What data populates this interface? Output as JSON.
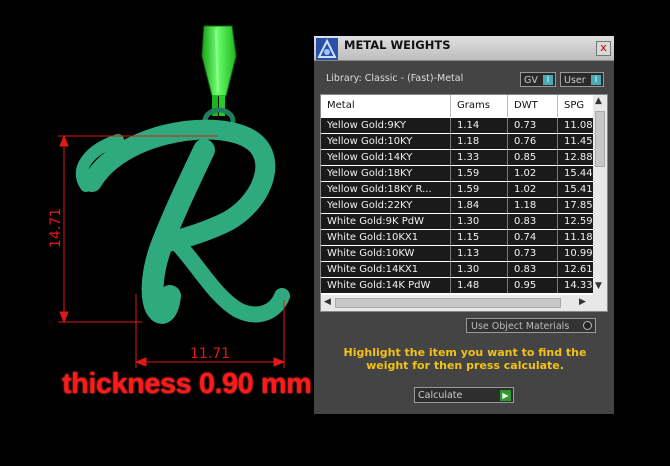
{
  "viewport": {
    "dimensions": {
      "height": "14.71",
      "width": "11.71"
    },
    "thickness_label": "thickness 0.90 mm",
    "colors": {
      "pendant": "#2eaa7e",
      "bail": "#33ee33",
      "dimension_lines": "#e01818"
    }
  },
  "panel": {
    "title": "METAL WEIGHTS",
    "close_glyph": "x",
    "library_label": "Library: Classic - (Fast)-Metal",
    "toggles": [
      {
        "label": "GV",
        "state": "I"
      },
      {
        "label": "User",
        "state": "I"
      }
    ],
    "table": {
      "columns": [
        "Metal",
        "Grams",
        "DWT",
        "SPG"
      ],
      "rows": [
        [
          "Yellow Gold:9KY",
          "1.14",
          "0.73",
          "11.08"
        ],
        [
          "Yellow Gold:10KY",
          "1.18",
          "0.76",
          "11.45"
        ],
        [
          "Yellow Gold:14KY",
          "1.33",
          "0.85",
          "12.88"
        ],
        [
          "Yellow Gold:18KY",
          "1.59",
          "1.02",
          "15.44"
        ],
        [
          "Yellow Gold:18KY R...",
          "1.59",
          "1.02",
          "15.41"
        ],
        [
          "Yellow Gold:22KY",
          "1.84",
          "1.18",
          "17.85"
        ],
        [
          "White Gold:9K PdW",
          "1.30",
          "0.83",
          "12.59"
        ],
        [
          "White Gold:10KX1",
          "1.15",
          "0.74",
          "11.18"
        ],
        [
          "White Gold:10KW",
          "1.13",
          "0.73",
          "10.99"
        ],
        [
          "White Gold:14KX1",
          "1.30",
          "0.83",
          "12.61"
        ],
        [
          "White Gold:14K PdW",
          "1.48",
          "0.95",
          "14.33"
        ]
      ]
    },
    "use_object_materials_label": "Use Object Materials",
    "instruction": "Highlight the item you want to find the weight for then press calculate.",
    "calculate_label": "Calculate",
    "colors": {
      "panel_bg": "#444444",
      "instruction": "#f2c218",
      "toggle_knob": "#49a9b4",
      "calc_arrow": "#2e9a2e"
    }
  }
}
